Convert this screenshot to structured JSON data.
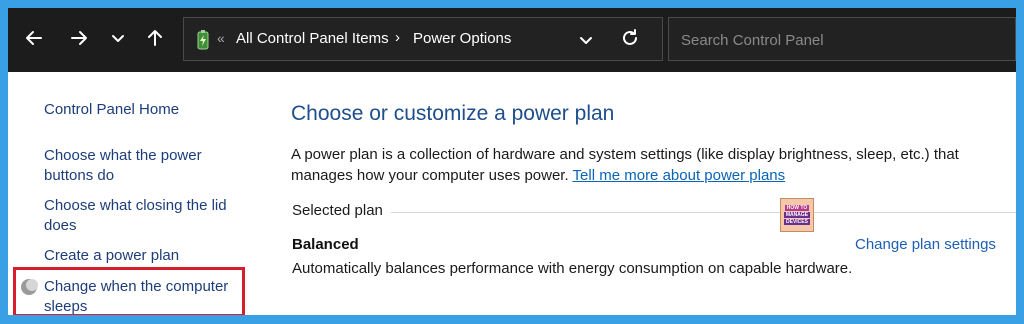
{
  "toolbar": {
    "back_icon": "arrow-left-icon",
    "forward_icon": "arrow-right-icon",
    "recent_icon": "chevron-down-icon",
    "up_icon": "arrow-up-icon",
    "refresh_icon": "refresh-icon"
  },
  "address": {
    "icon": "power-options-battery-icon",
    "separator": "«",
    "crumbs": [
      "All Control Panel Items",
      "Power Options"
    ],
    "crumb_arrow": "›"
  },
  "search": {
    "placeholder": "Search Control Panel",
    "value": ""
  },
  "sidebar": {
    "home": "Control Panel Home",
    "items": [
      {
        "label": "Choose what the power buttons do"
      },
      {
        "label": "Choose what closing the lid does"
      },
      {
        "label": "Create a power plan"
      },
      {
        "label": "Change when the computer sleeps"
      }
    ]
  },
  "main": {
    "title": "Choose or customize a power plan",
    "description": "A power plan is a collection of hardware and system settings (like display brightness, sleep, etc.) that manages how your computer uses power.",
    "learn_more": "Tell me more about power plans",
    "section_label": "Selected plan",
    "plan": {
      "name": "Balanced",
      "settings_link": "Change plan settings",
      "description": "Automatically balances performance with energy consumption on capable hardware."
    }
  },
  "watermark": {
    "line1": "HOW TO",
    "line2": "MANAGE",
    "line3": "DEVICES"
  },
  "colors": {
    "frame": "#3aa0e6",
    "toolbar_bg": "#1c1c1c",
    "highlight_border": "#d61f2c",
    "title": "#1e4e8c",
    "link": "#1d3d7a"
  }
}
